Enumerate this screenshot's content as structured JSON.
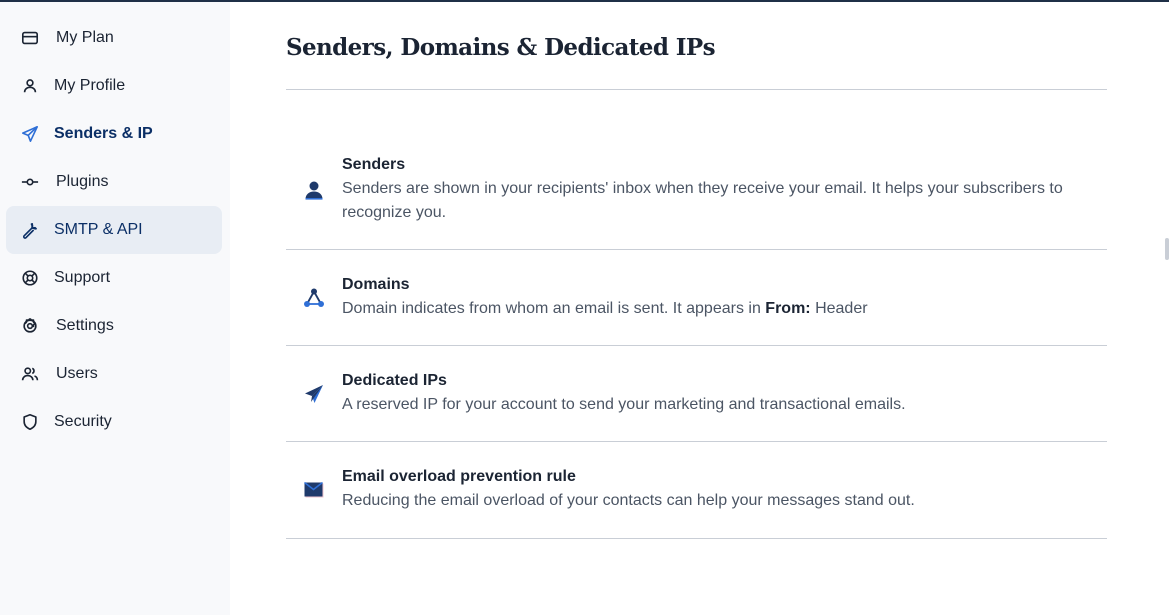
{
  "sidebar": {
    "items": [
      {
        "label": "My Plan",
        "icon": "credit-card-icon",
        "active": false
      },
      {
        "label": "My Profile",
        "icon": "user-icon",
        "active": false
      },
      {
        "label": "Senders & IP",
        "icon": "paper-plane-icon",
        "active": false
      },
      {
        "label": "Plugins",
        "icon": "plugin-icon",
        "active": false
      },
      {
        "label": "SMTP & API",
        "icon": "wrench-icon",
        "active": true
      },
      {
        "label": "Support",
        "icon": "lifebuoy-icon",
        "active": false
      },
      {
        "label": "Settings",
        "icon": "gear-icon",
        "active": false
      },
      {
        "label": "Users",
        "icon": "users-icon",
        "active": false
      },
      {
        "label": "Security",
        "icon": "shield-icon",
        "active": false
      }
    ]
  },
  "main": {
    "title": "Senders, Domains & Dedicated IPs",
    "sections": [
      {
        "title": "Senders",
        "icon": "person-icon",
        "description": "Senders are shown in your recipients' inbox when they receive your email. It helps your subscribers to recognize you."
      },
      {
        "title": "Domains",
        "icon": "network-icon",
        "description_before": "Domain indicates from whom an email is sent. It appears in ",
        "description_bold": "From:",
        "description_after": " Header"
      },
      {
        "title": "Dedicated IPs",
        "icon": "send-icon",
        "description": "A reserved IP for your account to send your marketing and transactional emails."
      },
      {
        "title": "Email overload prevention rule",
        "icon": "envelope-icon",
        "description": "Reducing the email overload of your contacts can help your messages stand out."
      }
    ]
  },
  "colors": {
    "accent": "#0b2f66",
    "sidebar_bg": "#f8f9fb",
    "active_bg": "#e8edf4",
    "icon_blue": "#2f6fd6",
    "icon_navy": "#1f3a6b"
  }
}
